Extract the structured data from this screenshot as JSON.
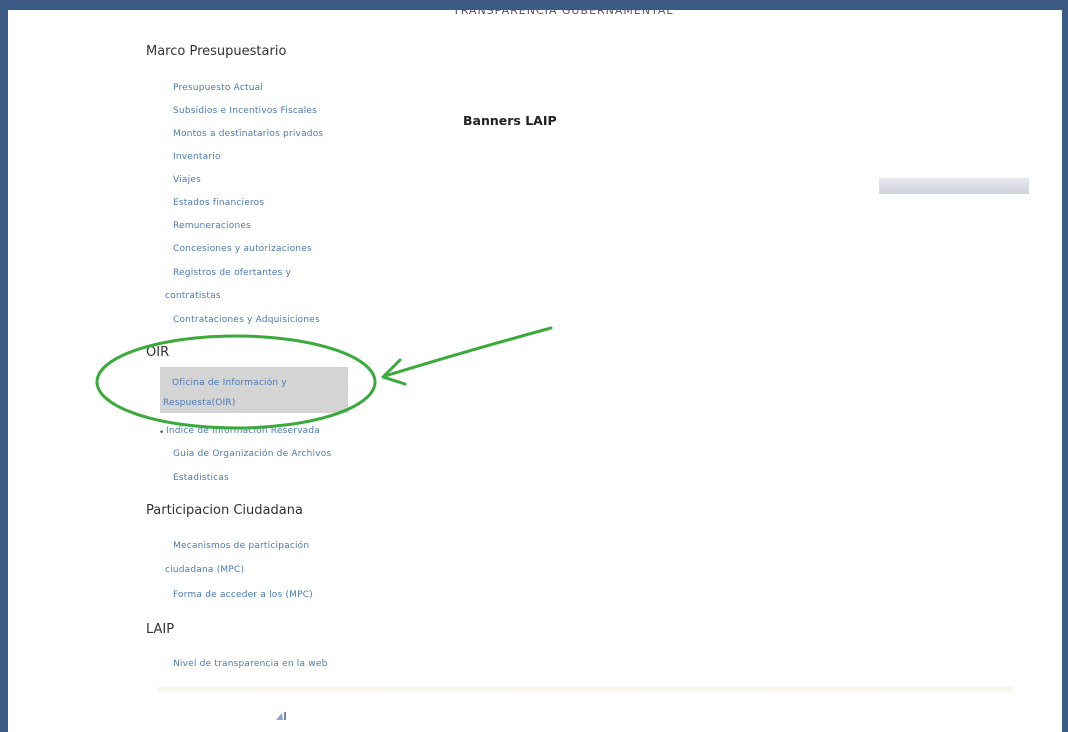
{
  "header": {
    "cut_title": "TRANSPARENCIA GUBERNAMENTAL"
  },
  "sidebar": {
    "sections": [
      {
        "heading": "Marco Presupuestario",
        "links": [
          "Presupuesto Actual",
          "Subsidios e Incentivos Fiscales",
          "Montos a destinatarios privados",
          "Inventario",
          "Viajes",
          "Estados financieros",
          "Remuneraciones",
          "Concesiones y autorizaciones",
          "Registros de ofertantes y",
          "contratistas",
          "Contrataciones y Adquisiciones"
        ]
      },
      {
        "heading": "OIR",
        "links": [
          "Oficina de Información y",
          "Respuesta(OIR)",
          "Indice de Informacion Reservada",
          "Guia de Organización de Archivos",
          "Estadisticas"
        ]
      },
      {
        "heading": "Participacion Ciudadana",
        "links": [
          "Mecanismos de participación",
          "ciudadana (MPC)",
          "Forma de acceder a los (MPC)"
        ]
      },
      {
        "heading": "LAIP",
        "links": [
          "Nivel de transparencia en la web"
        ]
      }
    ]
  },
  "main": {
    "banners_title": "Banners LAIP"
  },
  "colors": {
    "frame": "#3c5a86",
    "link": "#4a7ab8",
    "annotation": "#3aaa3a",
    "highlight": "#d4d4d4"
  },
  "icons": {
    "footer": "small-logo-icon"
  }
}
